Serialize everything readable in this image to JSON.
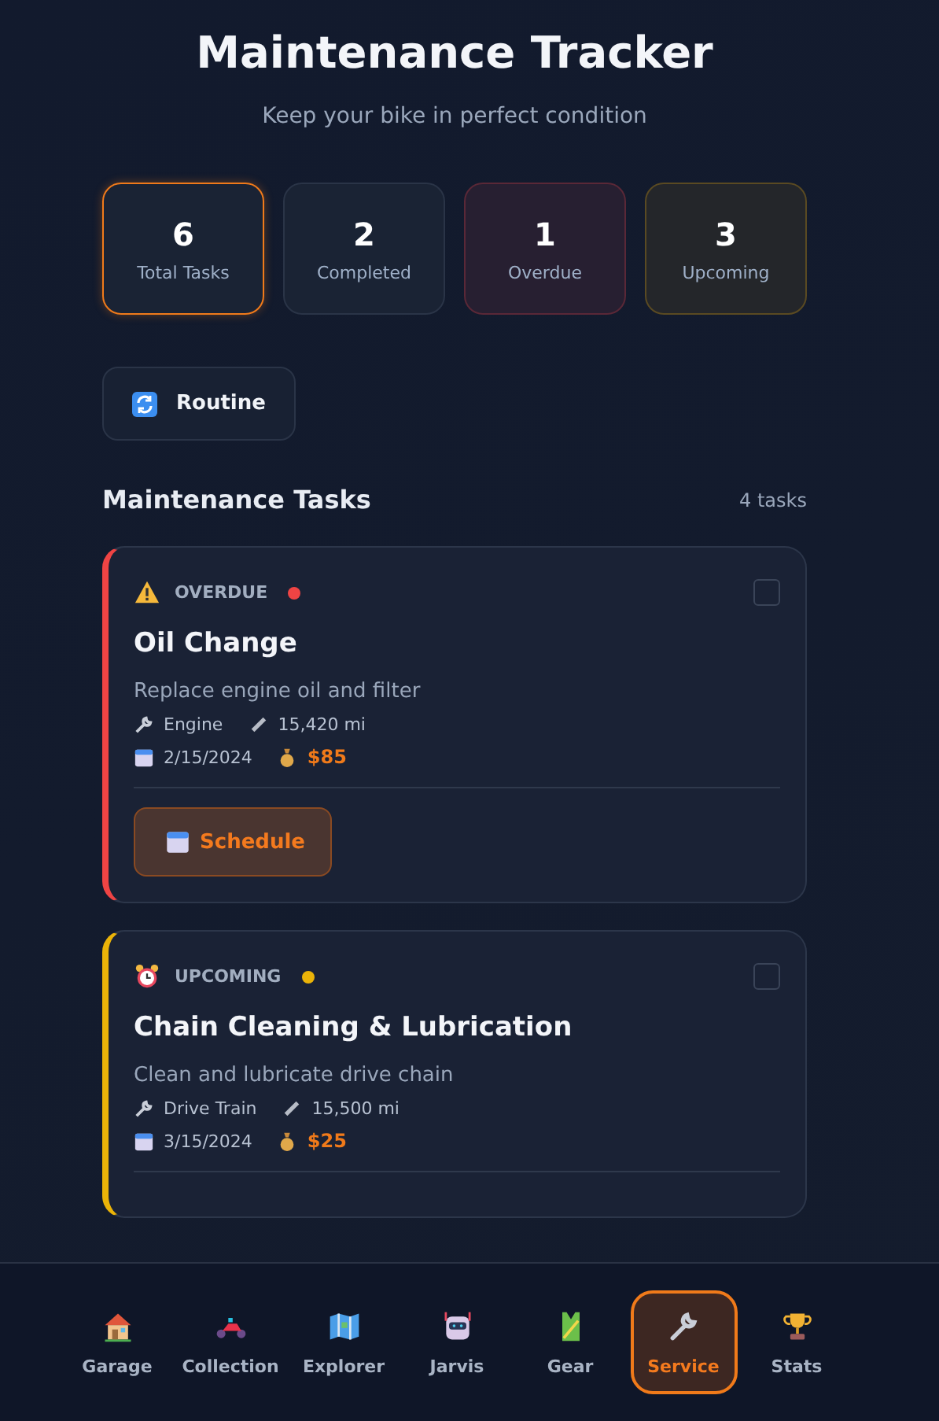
{
  "header": {
    "title": "Maintenance Tracker",
    "subtitle": "Keep your bike in perfect condition"
  },
  "stats": [
    {
      "kind": "total",
      "value": "6",
      "label": "Total Tasks",
      "selected": true
    },
    {
      "kind": "completed",
      "value": "2",
      "label": "Completed",
      "selected": false
    },
    {
      "kind": "overdue",
      "value": "1",
      "label": "Overdue",
      "selected": false
    },
    {
      "kind": "upcoming",
      "value": "3",
      "label": "Upcoming",
      "selected": false
    }
  ],
  "routine_button": {
    "label": "Routine"
  },
  "section": {
    "title": "Maintenance Tasks",
    "count": "4 tasks"
  },
  "tasks": [
    {
      "kind": "overdue",
      "status": "OVERDUE",
      "color": "#ef4444",
      "checked": false,
      "title": "Oil Change",
      "description": "Replace engine oil and filter",
      "category": "Engine",
      "mileage": "15,420 mi",
      "date": "2/15/2024",
      "cost": "$85",
      "action": "Schedule"
    },
    {
      "kind": "upcoming",
      "status": "UPCOMING",
      "color": "#eab308",
      "checked": false,
      "title": "Chain Cleaning & Lubrication",
      "description": "Clean and lubricate drive chain",
      "category": "Drive Train",
      "mileage": "15,500 mi",
      "date": "3/15/2024",
      "cost": "$25"
    }
  ],
  "nav": [
    {
      "kind": "garage",
      "label": "Garage",
      "selected": false
    },
    {
      "kind": "collection",
      "label": "Collection",
      "selected": false
    },
    {
      "kind": "explorer",
      "label": "Explorer",
      "selected": false
    },
    {
      "kind": "jarvis",
      "label": "Jarvis",
      "selected": false
    },
    {
      "kind": "gear",
      "label": "Gear",
      "selected": false
    },
    {
      "kind": "service",
      "label": "Service",
      "selected": true
    },
    {
      "kind": "stats",
      "label": "Stats",
      "selected": false
    }
  ]
}
